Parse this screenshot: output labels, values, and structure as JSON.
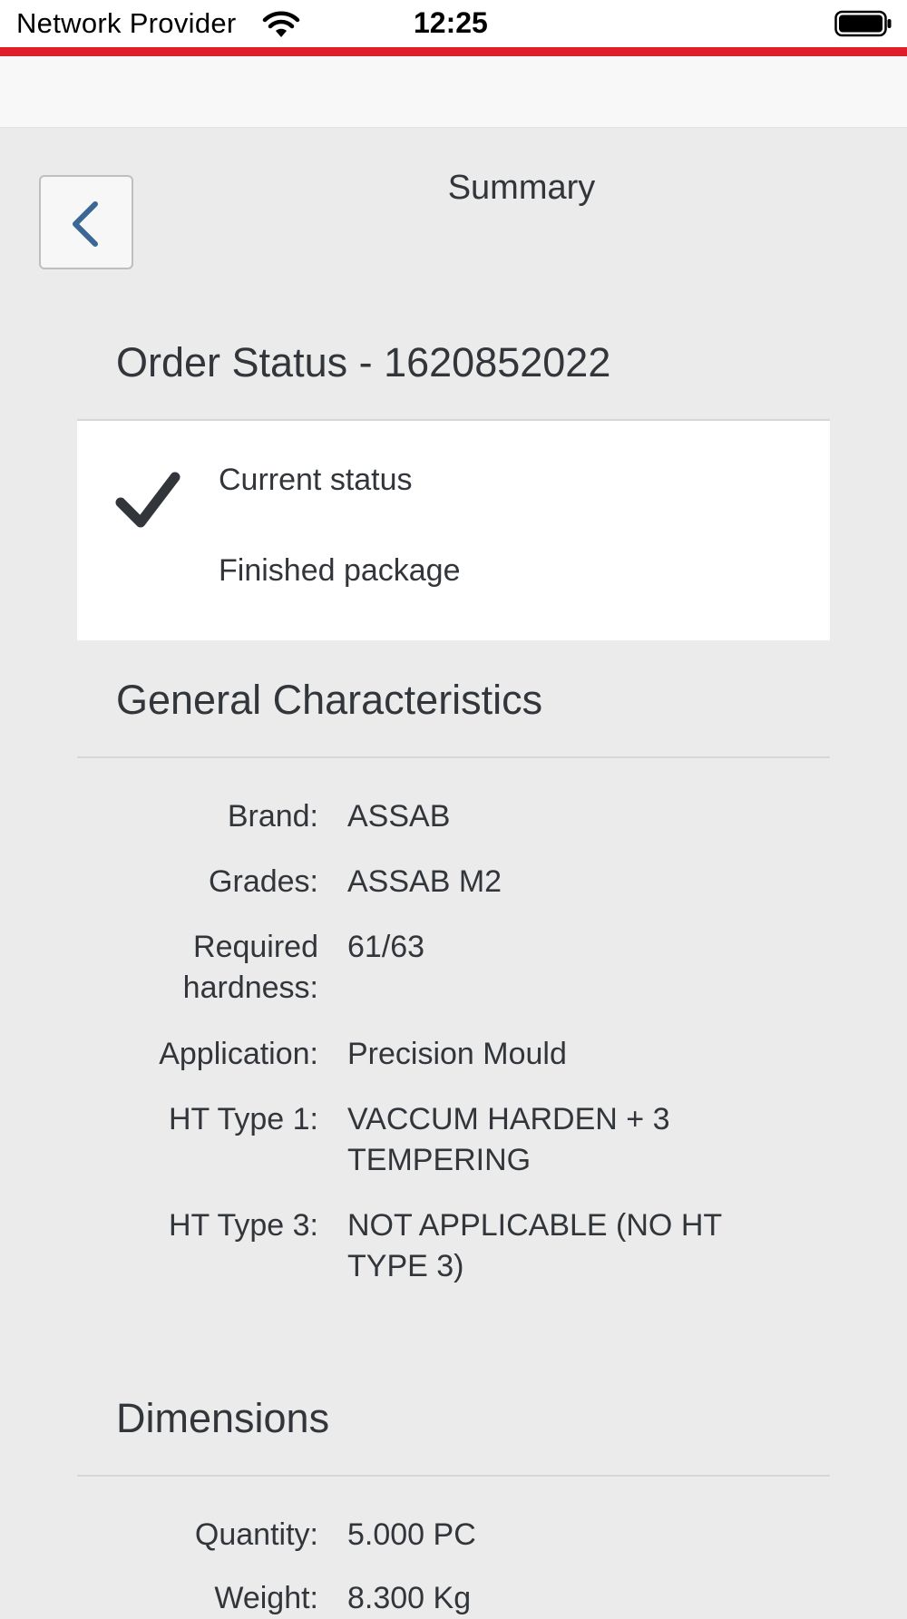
{
  "status_bar": {
    "carrier": "Network Provider",
    "time": "12:25",
    "wifi_icon": "wifi-icon",
    "battery_icon": "battery-icon"
  },
  "colors": {
    "brand_red": "#e01e2b",
    "back_arrow": "#3a6796",
    "background": "#ebebeb"
  },
  "header": {
    "title": "Summary",
    "back_icon": "chevron-left-icon"
  },
  "order_status": {
    "title": "Order Status - 1620852022",
    "status_icon": "check-icon",
    "status_label": "Current status",
    "status_value": "Finished package"
  },
  "general": {
    "title": "General Characteristics",
    "rows": [
      {
        "label": "Brand:",
        "value": "ASSAB"
      },
      {
        "label": "Grades:",
        "value": "ASSAB M2"
      },
      {
        "label": "Required hardness:",
        "value": "61/63"
      },
      {
        "label": "Application:",
        "value": "Precision Mould"
      },
      {
        "label": "HT Type 1:",
        "value": "VACCUM HARDEN + 3 TEMPERING"
      },
      {
        "label": "HT Type 3:",
        "value": "NOT APPLICABLE (NO HT TYPE 3)"
      }
    ]
  },
  "dimensions": {
    "title": "Dimensions",
    "rows": [
      {
        "label": "Quantity:",
        "value": "5.000 PC"
      },
      {
        "label": "Weight:",
        "value": "8.300 Kg"
      }
    ]
  }
}
